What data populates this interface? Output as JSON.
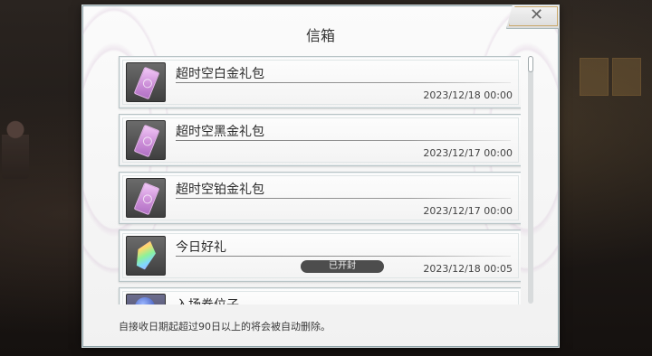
{
  "window": {
    "title": "信箱"
  },
  "mails": [
    {
      "name": "超时空白金礼包",
      "date": "2023/12/18 00:00",
      "icon": "ticket-icon",
      "opened": false
    },
    {
      "name": "超时空黑金礼包",
      "date": "2023/12/17 00:00",
      "icon": "ticket-icon",
      "opened": false
    },
    {
      "name": "超时空铂金礼包",
      "date": "2023/12/17 00:00",
      "icon": "ticket-icon",
      "opened": false
    },
    {
      "name": "今日好礼",
      "date": "2023/12/18 00:05",
      "icon": "crystal-icon",
      "opened": true,
      "badge": "已开封"
    },
    {
      "name": "入场券位子",
      "date": "",
      "icon": "orb-icon",
      "opened": false
    }
  ],
  "footer": {
    "note": "自接收日期起超过90日以上的将会被自动删除。"
  },
  "colors": {
    "modal_bg": "#f6f6f6",
    "badge_bg": "#4d4d4d",
    "ticket": "#c98ad6"
  }
}
